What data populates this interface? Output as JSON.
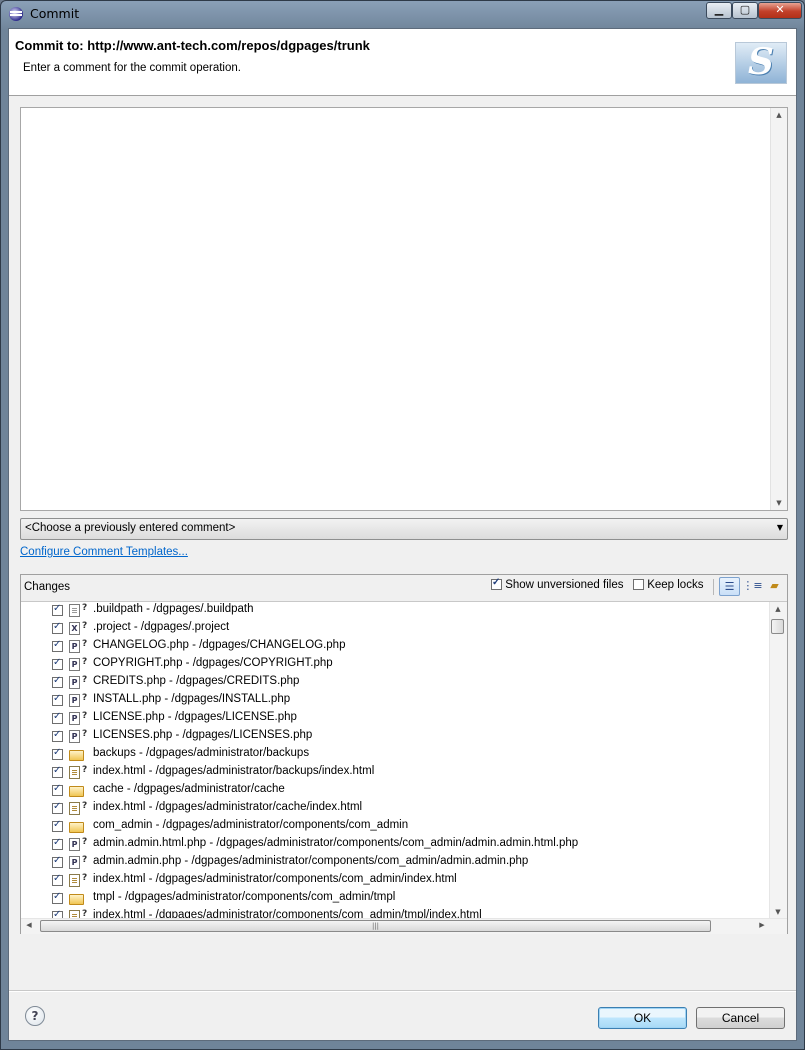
{
  "window": {
    "title": "Commit",
    "minimize_icon": "minimize-icon",
    "maximize_icon": "maximize-icon",
    "close_icon": "close-icon"
  },
  "header": {
    "title": "Commit to: http://www.ant-tech.com/repos/dgpages/trunk",
    "subtitle": "Enter a comment for the commit operation."
  },
  "comment": {
    "value": "",
    "previous_comment_placeholder": "<Choose a previously entered comment>"
  },
  "configure_link": "Configure Comment Templates...",
  "changes": {
    "label": "Changes",
    "show_unversioned_label": "Show unversioned files",
    "show_unversioned_checked": true,
    "keep_locks_label": "Keep locks",
    "keep_locks_checked": false,
    "items": [
      {
        "label": ".buildpath - /dgpages/.buildpath",
        "icon": "file",
        "checked": true
      },
      {
        "label": ".project - /dgpages/.project",
        "icon": "xml",
        "checked": true
      },
      {
        "label": "CHANGELOG.php - /dgpages/CHANGELOG.php",
        "icon": "php",
        "checked": true
      },
      {
        "label": "COPYRIGHT.php - /dgpages/COPYRIGHT.php",
        "icon": "php",
        "checked": true
      },
      {
        "label": "CREDITS.php - /dgpages/CREDITS.php",
        "icon": "php",
        "checked": true
      },
      {
        "label": "INSTALL.php - /dgpages/INSTALL.php",
        "icon": "php",
        "checked": true
      },
      {
        "label": "LICENSE.php - /dgpages/LICENSE.php",
        "icon": "php",
        "checked": true
      },
      {
        "label": "LICENSES.php - /dgpages/LICENSES.php",
        "icon": "php",
        "checked": true
      },
      {
        "label": "backups - /dgpages/administrator/backups",
        "icon": "folder",
        "checked": true
      },
      {
        "label": "index.html - /dgpages/administrator/backups/index.html",
        "icon": "html",
        "checked": true
      },
      {
        "label": "cache - /dgpages/administrator/cache",
        "icon": "folder",
        "checked": true
      },
      {
        "label": "index.html - /dgpages/administrator/cache/index.html",
        "icon": "html",
        "checked": true
      },
      {
        "label": "com_admin - /dgpages/administrator/components/com_admin",
        "icon": "folder",
        "checked": true
      },
      {
        "label": "admin.admin.html.php - /dgpages/administrator/components/com_admin/admin.admin.html.php",
        "icon": "php",
        "checked": true
      },
      {
        "label": "admin.admin.php - /dgpages/administrator/components/com_admin/admin.admin.php",
        "icon": "php",
        "checked": true
      },
      {
        "label": "index.html - /dgpages/administrator/components/com_admin/index.html",
        "icon": "html",
        "checked": true
      },
      {
        "label": "tmpl - /dgpages/administrator/components/com_admin/tmpl",
        "icon": "folder",
        "checked": true
      },
      {
        "label": "index.html - /dgpages/administrator/components/com_admin/tmpl/index.html",
        "icon": "html",
        "checked": true
      }
    ]
  },
  "buttons": {
    "ok": "OK",
    "cancel": "Cancel",
    "help_icon": "help-icon"
  }
}
